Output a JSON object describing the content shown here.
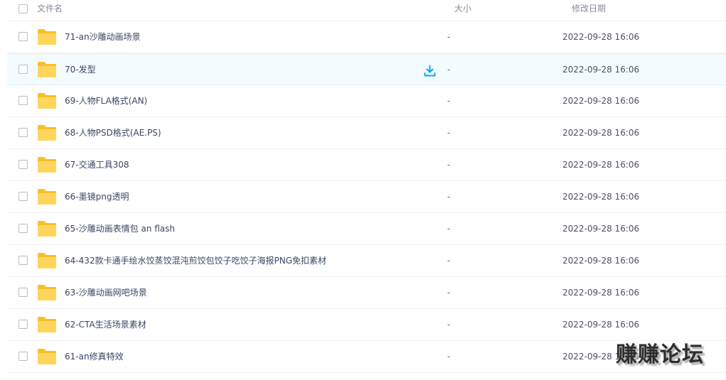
{
  "header": {
    "name_label": "文件名",
    "size_label": "大小",
    "date_label": "修改日期"
  },
  "rows": [
    {
      "name": "71-an沙雕动画场景",
      "size": "-",
      "date": "2022-09-28 16:06"
    },
    {
      "name": "70-发型",
      "size": "-",
      "date": "2022-09-28 16:06"
    },
    {
      "name": "69-人物FLA格式(AN)",
      "size": "-",
      "date": "2022-09-28 16:06"
    },
    {
      "name": "68-人物PSD格式(AE.PS)",
      "size": "-",
      "date": "2022-09-28 16:06"
    },
    {
      "name": "67-交通工具308",
      "size": "-",
      "date": "2022-09-28 16:06"
    },
    {
      "name": "66-墨镜png透明",
      "size": "-",
      "date": "2022-09-28 16:06"
    },
    {
      "name": "65-沙雕动画表情包 an flash",
      "size": "-",
      "date": "2022-09-28 16:06"
    },
    {
      "name": "64-432款卡通手绘水饺蒸饺混沌煎饺包饺子吃饺子海报PNG免扣素材",
      "size": "-",
      "date": "2022-09-28 16:06"
    },
    {
      "name": "63-沙雕动画网吧场景",
      "size": "-",
      "date": "2022-09-28 16:06"
    },
    {
      "name": "62-CTA生活场景素材",
      "size": "-",
      "date": "2022-09-28 16:06"
    },
    {
      "name": "61-an修真特效",
      "size": "-",
      "date": "2022-09-28 16:06"
    }
  ],
  "hovered_row_index": 1,
  "icons": {
    "folder": "folder-icon",
    "download": "download-icon"
  },
  "colors": {
    "folder": "#ffd55c",
    "accent": "#06a7ff",
    "hover_bg": "#f4fbff"
  },
  "watermark": "赚赚论坛"
}
